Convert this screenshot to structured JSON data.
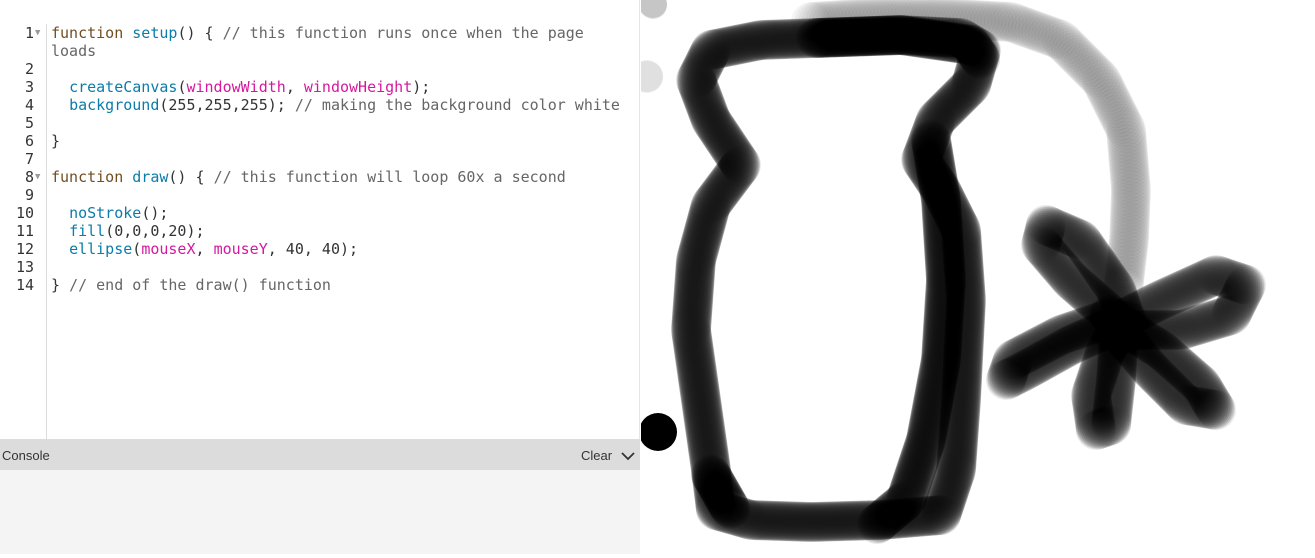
{
  "editor": {
    "lines": [
      {
        "n": "1",
        "fold": true,
        "tokens": [
          [
            "kw",
            "function "
          ],
          [
            "fn",
            "setup"
          ],
          [
            "pl",
            "() { "
          ],
          [
            "cm",
            "// this function runs once when the page"
          ]
        ]
      },
      {
        "n": "",
        "fold": false,
        "tokens": [
          [
            "cm",
            "loads"
          ]
        ]
      },
      {
        "n": "2",
        "fold": false,
        "tokens": []
      },
      {
        "n": "3",
        "fold": false,
        "tokens": [
          [
            "pl",
            "  "
          ],
          [
            "fn",
            "createCanvas"
          ],
          [
            "pl",
            "("
          ],
          [
            "var",
            "windowWidth"
          ],
          [
            "pl",
            ", "
          ],
          [
            "var",
            "windowHeight"
          ],
          [
            "pl",
            ");"
          ]
        ]
      },
      {
        "n": "4",
        "fold": false,
        "tokens": [
          [
            "pl",
            "  "
          ],
          [
            "fn",
            "background"
          ],
          [
            "pl",
            "(255,255,255); "
          ],
          [
            "cm",
            "// making the background color white"
          ]
        ]
      },
      {
        "n": "5",
        "fold": false,
        "tokens": []
      },
      {
        "n": "6",
        "fold": false,
        "tokens": [
          [
            "pl",
            "}"
          ]
        ]
      },
      {
        "n": "7",
        "fold": false,
        "tokens": []
      },
      {
        "n": "8",
        "fold": true,
        "tokens": [
          [
            "kw",
            "function "
          ],
          [
            "fn",
            "draw"
          ],
          [
            "pl",
            "() { "
          ],
          [
            "cm",
            "// this function will loop 60x a second"
          ]
        ]
      },
      {
        "n": "9",
        "fold": false,
        "tokens": []
      },
      {
        "n": "10",
        "fold": false,
        "tokens": [
          [
            "pl",
            "  "
          ],
          [
            "fn",
            "noStroke"
          ],
          [
            "pl",
            "();"
          ]
        ]
      },
      {
        "n": "11",
        "fold": false,
        "tokens": [
          [
            "pl",
            "  "
          ],
          [
            "fn",
            "fill"
          ],
          [
            "pl",
            "(0,0,0,20);"
          ]
        ]
      },
      {
        "n": "12",
        "fold": false,
        "tokens": [
          [
            "pl",
            "  "
          ],
          [
            "fn",
            "ellipse"
          ],
          [
            "pl",
            "("
          ],
          [
            "var",
            "mouseX"
          ],
          [
            "pl",
            ", "
          ],
          [
            "var",
            "mouseY"
          ],
          [
            "pl",
            ", 40, 40);"
          ]
        ]
      },
      {
        "n": "13",
        "fold": false,
        "tokens": []
      },
      {
        "n": "14",
        "fold": false,
        "tokens": [
          [
            "pl",
            "} "
          ],
          [
            "cm",
            "// end of the draw() function"
          ]
        ]
      }
    ]
  },
  "console": {
    "title": "Console",
    "clear_label": "Clear",
    "collapse_icon": "chevron-down-icon"
  },
  "canvas": {
    "brush": {
      "color": "#000000",
      "alpha": 20,
      "diameter": 40
    }
  },
  "colors": {
    "keyword": "#704f21",
    "function": "#0b7ca9",
    "variable": "#d5189f",
    "comment": "#666666",
    "console_bar": "#dcdcdc",
    "console_body": "#f4f4f4"
  }
}
